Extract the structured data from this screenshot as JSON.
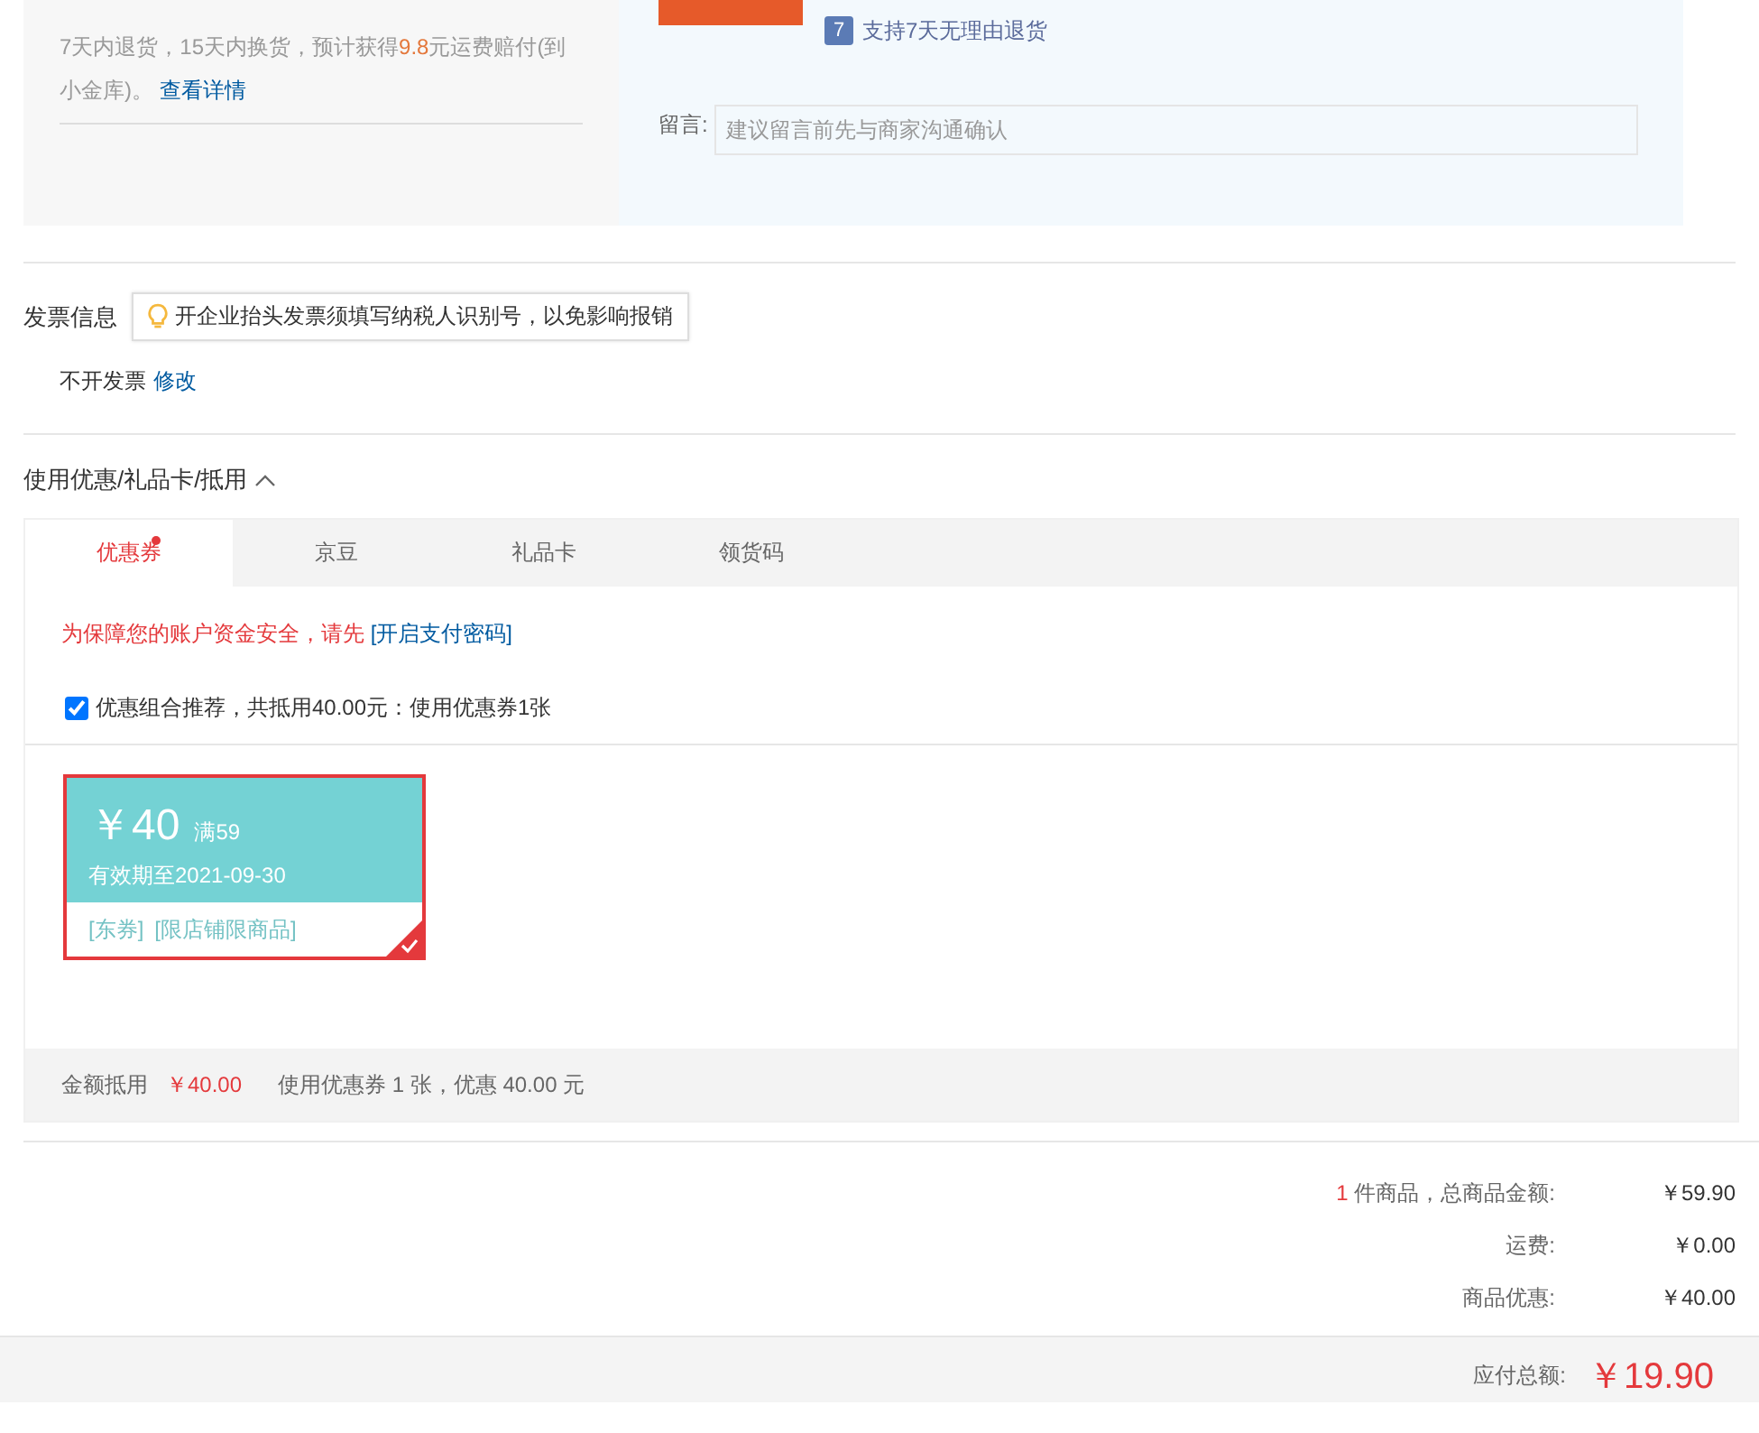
{
  "returns": {
    "note": "7天内退货，15天内换货，预计获得**9.8**元运费赔付(到小金库)。",
    "link": "查看详情"
  },
  "service": {
    "badge": "7",
    "text": "支持7天无理由退货"
  },
  "message": {
    "label": "留言:",
    "placeholder": "建议留言前先与商家沟通确认"
  },
  "invoice": {
    "title": "发票信息",
    "tip": "开企业抬头发票须填写纳税人识别号，以免影响报销",
    "value": "不开发票",
    "edit": "修改"
  },
  "discounts": {
    "title": "使用优惠/礼品卡/抵用",
    "expanded": true,
    "tabs": [
      {
        "label": "优惠券",
        "selected": true,
        "dot": true
      },
      {
        "label": "京豆",
        "selected": false,
        "dot": false
      },
      {
        "label": "礼品卡",
        "selected": false,
        "dot": false
      },
      {
        "label": "领货码",
        "selected": false,
        "dot": false
      }
    ],
    "warning": "为保障您的账户资金安全，请先",
    "warning_link": "[开启支付密码]",
    "combo": {
      "label": "优惠组合推荐，共抵用40.00元：使用优惠券1张",
      "checked": true
    },
    "coupons": [
      {
        "amount": "￥40",
        "condition": "满59",
        "validity": "有效期至2021-09-30",
        "tags": [
          "[东券]",
          "[限店铺限商品]"
        ],
        "selected": true
      }
    ],
    "footer": {
      "label": "金额抵用",
      "amount": "￥40.00",
      "summary": "使用优惠券 1 张，优惠 40.00 元"
    }
  },
  "summary": {
    "rows": [
      {
        "count": "1",
        "label": "件商品，总商品金额:",
        "value": "￥59.90"
      },
      {
        "count": "",
        "label": "运费:",
        "value": "￥0.00"
      },
      {
        "count": "",
        "label": "商品优惠:",
        "value": "￥40.00"
      }
    ],
    "total_label": "应付总额:",
    "total": "￥19.90"
  }
}
